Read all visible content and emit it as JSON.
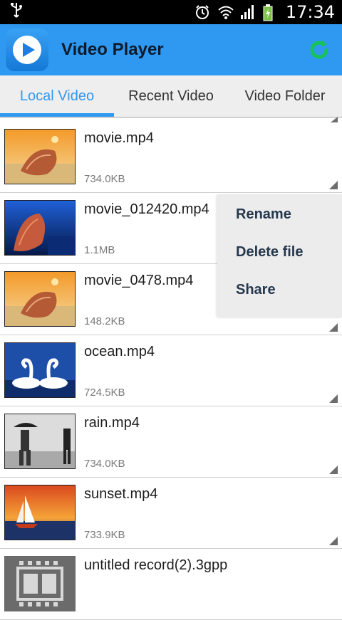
{
  "status_bar": {
    "time": "17:34",
    "icons": [
      "usb-icon",
      "alarm-icon",
      "wifi-icon",
      "signal-icon",
      "battery-charging-icon"
    ]
  },
  "app_bar": {
    "title": "Video Player",
    "logo_icon": "play-icon",
    "action_icon": "refresh-icon",
    "brand_color": "#2f99f2"
  },
  "tabs": [
    {
      "label": "Local Video",
      "active": true
    },
    {
      "label": "Recent Video",
      "active": false
    },
    {
      "label": "Video Folder",
      "active": false
    }
  ],
  "videos": [
    {
      "name": "movie.mp4",
      "size": "734.0KB",
      "thumb": "seashell-on-beach"
    },
    {
      "name": "movie_012420.mp4",
      "size": "1.1MB",
      "thumb": "coral-reef"
    },
    {
      "name": "movie_0478.mp4",
      "size": "148.2KB",
      "thumb": "seashell-on-beach"
    },
    {
      "name": "ocean.mp4",
      "size": "724.5KB",
      "thumb": "two-swans"
    },
    {
      "name": "rain.mp4",
      "size": "734.0KB",
      "thumb": "people-in-rain"
    },
    {
      "name": "sunset.mp4",
      "size": "733.9KB",
      "thumb": "sailboat-sunset"
    },
    {
      "name": "untitled record(2).3gpp",
      "size": "",
      "thumb": "film-placeholder"
    }
  ],
  "context_menu": {
    "items": [
      "Rename",
      "Delete file",
      "Share"
    ]
  }
}
